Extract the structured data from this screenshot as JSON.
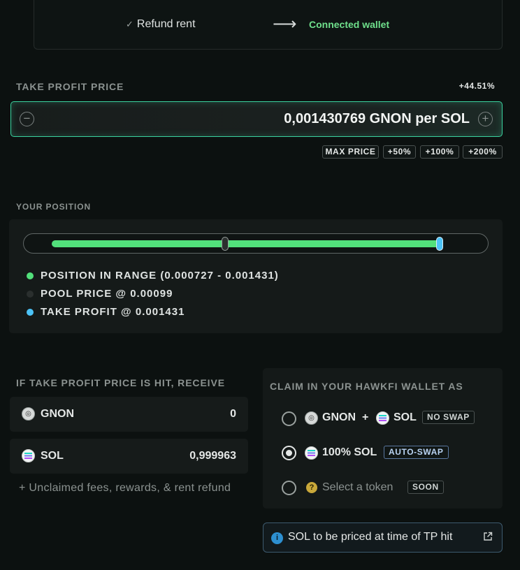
{
  "top_card": {
    "refund_label": "Refund rent",
    "connected_label": "Connected wallet"
  },
  "take_profit": {
    "label": "TAKE PROFIT PRICE",
    "percent": "+44.51%",
    "value": "0,001430769 GNON per SOL",
    "chips": [
      "MAX PRICE",
      "+50%",
      "+100%",
      "+200%"
    ]
  },
  "position": {
    "label": "YOUR POSITION",
    "pool_price_fraction": 0.42,
    "take_profit_fraction": 0.94,
    "legend": [
      {
        "text": "POSITION IN RANGE (0.000727 - 0.001431)",
        "color": "#52e07b"
      },
      {
        "text": "POOL PRICE @ 0.00099",
        "color": "#2a2f2e"
      },
      {
        "text": "TAKE PROFIT @ 0.001431",
        "color": "#4cc3f7"
      }
    ]
  },
  "receive": {
    "label": "IF TAKE PROFIT PRICE IS HIT, RECEIVE",
    "rows": [
      {
        "token": "GNON",
        "value": "0"
      },
      {
        "token": "SOL",
        "value": "0,999963"
      }
    ],
    "note": "+ Unclaimed fees, rewards, & rent refund"
  },
  "claim": {
    "label": "CLAIM IN YOUR HAWKFI WALLET AS",
    "options": [
      {
        "token_a": "GNON",
        "plus": "+",
        "token_b": "SOL",
        "tag": "NO SWAP",
        "selected": false
      },
      {
        "text": "100% SOL",
        "tag": "AUTO-SWAP",
        "selected": true
      },
      {
        "text": "Select a token",
        "tag": "SOON",
        "selected": false
      }
    ]
  },
  "info": {
    "text": "SOL to be priced at time of TP hit"
  },
  "colors": {
    "accent_green": "#52e07b",
    "connected_green": "#6fe08c",
    "take_profit_blue": "#4cc3f7",
    "border_teal": "#3ad29f"
  }
}
